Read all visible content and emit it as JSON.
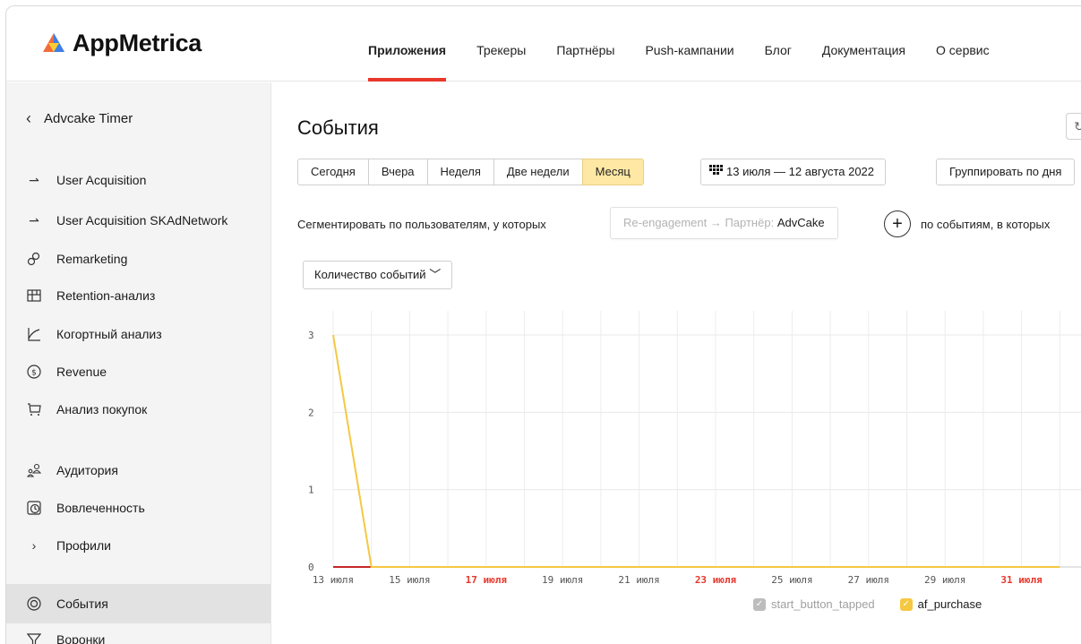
{
  "app": {
    "logo_text": "AppMetrica"
  },
  "nav": {
    "items": [
      {
        "label": "Приложения",
        "active": true
      },
      {
        "label": "Трекеры"
      },
      {
        "label": "Партнёры"
      },
      {
        "label": "Push-кампании"
      },
      {
        "label": "Блог"
      },
      {
        "label": "Документация"
      },
      {
        "label": "О сервис"
      }
    ]
  },
  "sidebar": {
    "app_name": "Advcake Timer",
    "items": [
      {
        "label": "User Acquisition",
        "icon": "arrow-right-icon"
      },
      {
        "label": "User Acquisition SKAdNetwork",
        "icon": "arrow-right-icon"
      },
      {
        "label": "Remarketing",
        "icon": "remarketing-icon"
      },
      {
        "label": "Retention-анализ",
        "icon": "grid-icon"
      },
      {
        "label": "Когортный анализ",
        "icon": "cohort-chart-icon"
      },
      {
        "label": "Revenue",
        "icon": "dollar-icon"
      },
      {
        "label": "Анализ покупок",
        "icon": "cart-icon"
      },
      {
        "label": "Аудитория",
        "icon": "audience-icon"
      },
      {
        "label": "Вовлеченность",
        "icon": "clock-icon"
      },
      {
        "label": "Профили",
        "icon": "chevron-right-icon"
      },
      {
        "label": "События",
        "icon": "target-icon",
        "active": true
      },
      {
        "label": "Воронки",
        "icon": "funnel-icon"
      }
    ]
  },
  "main": {
    "title": "События",
    "periods": [
      "Сегодня",
      "Вчера",
      "Неделя",
      "Две недели",
      "Месяц"
    ],
    "selected_period": "Месяц",
    "date_range": "13 июля — 12 августа 2022",
    "group_by": "Группировать по дня",
    "segment_prefix": "Сегментировать по пользователям, у которых",
    "segment_chip_muted": "Re-engagement → Партнёр:",
    "segment_chip_value": "AdvCake",
    "segment_events_label": "по событиям, в которых",
    "metric_selector": "Количество событий",
    "plus": "+"
  },
  "colors": {
    "accent_red": "#e8372c",
    "selected_period_bg": "#ffe8a3",
    "series_af_purchase": "#f5c842",
    "series_start_button_tapped": "#c62828",
    "legend_disabled": "#bdbdbd"
  },
  "chart_data": {
    "type": "line",
    "x_tick_labels": [
      "13 июля",
      "15 июля",
      "17 июля",
      "19 июля",
      "21 июля",
      "23 июля",
      "25 июля",
      "27 июля",
      "29 июля",
      "31 июля"
    ],
    "weekend_tick_labels": [
      "17 июля",
      "23 июля",
      "31 июля"
    ],
    "y_ticks": [
      0,
      1,
      2,
      3
    ],
    "ylim": [
      0,
      3
    ],
    "grid": true,
    "legend_position": "bottom",
    "x": [
      "13 июля",
      "14 июля",
      "15 июля",
      "16 июля",
      "17 июля",
      "18 июля",
      "19 июля",
      "20 июля",
      "21 июля",
      "22 июля",
      "23 июля",
      "24 июля",
      "25 июля",
      "26 июля",
      "27 июля",
      "28 июля",
      "29 июля",
      "30 июля",
      "31 июля",
      "1 августа"
    ],
    "series": [
      {
        "name": "start_button_tapped",
        "enabled": false,
        "values": [
          0,
          0,
          0,
          0,
          0,
          0,
          0,
          0,
          0,
          0,
          0,
          0,
          0,
          0,
          0,
          0,
          0,
          0,
          0,
          0
        ]
      },
      {
        "name": "af_purchase",
        "enabled": true,
        "values": [
          3,
          0,
          0,
          0,
          0,
          0,
          0,
          0,
          0,
          0,
          0,
          0,
          0,
          0,
          0,
          0,
          0,
          0,
          0,
          0
        ]
      }
    ]
  }
}
